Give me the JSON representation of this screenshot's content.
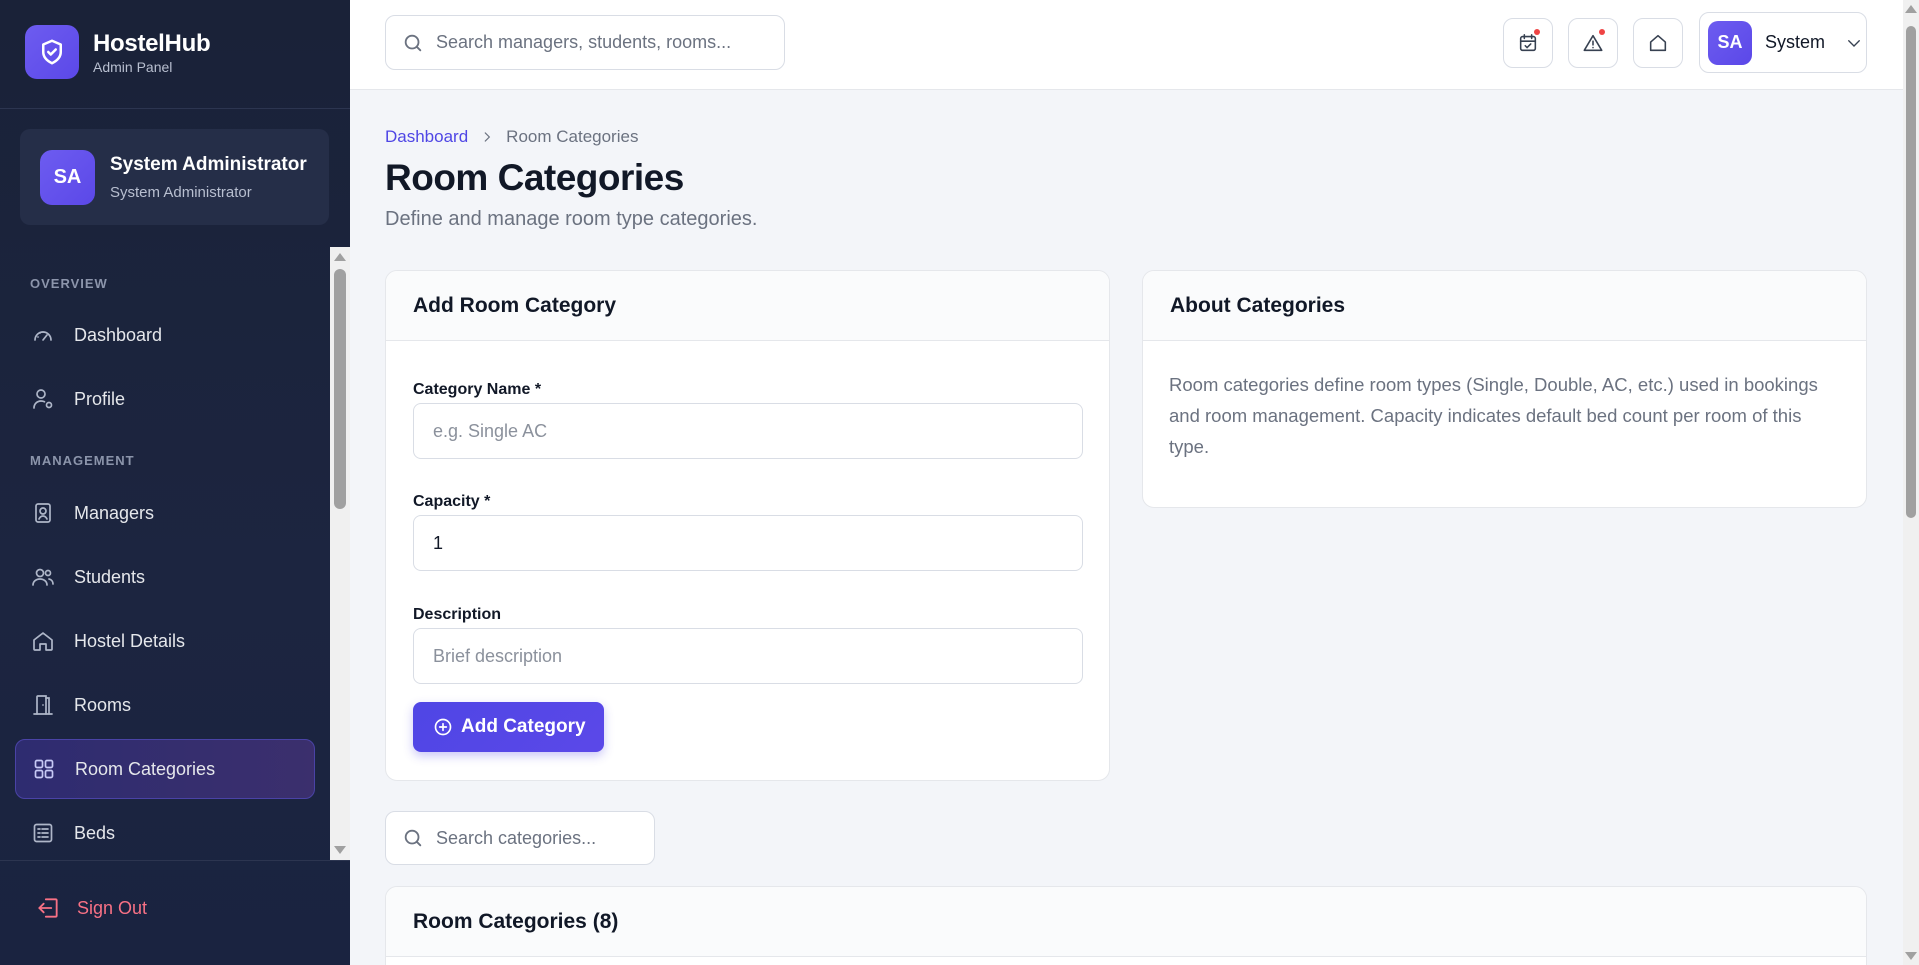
{
  "brand": {
    "name": "HostelHub",
    "subtitle": "Admin Panel"
  },
  "user": {
    "initials": "SA",
    "name": "System Administrator",
    "role": "System Administrator"
  },
  "nav": {
    "sections": [
      {
        "title": "OVERVIEW",
        "items": [
          {
            "label": "Dashboard",
            "icon": "gauge-icon"
          },
          {
            "label": "Profile",
            "icon": "user-gear-icon"
          }
        ]
      },
      {
        "title": "MANAGEMENT",
        "items": [
          {
            "label": "Managers",
            "icon": "id-badge-icon"
          },
          {
            "label": "Students",
            "icon": "users-icon"
          },
          {
            "label": "Hostel Details",
            "icon": "house-icon"
          },
          {
            "label": "Rooms",
            "icon": "door-icon"
          },
          {
            "label": "Room Categories",
            "icon": "grid-icon"
          },
          {
            "label": "Beds",
            "icon": "bed-list-icon"
          }
        ]
      }
    ],
    "active": "Room Categories",
    "sign_out": "Sign Out"
  },
  "topbar": {
    "search_placeholder": "Search managers, students, rooms...",
    "buttons": [
      {
        "icon": "calendar-check-icon",
        "badge": true
      },
      {
        "icon": "warning-icon",
        "badge": true
      },
      {
        "icon": "home-icon",
        "badge": false
      }
    ],
    "profile": {
      "initials": "SA",
      "name": "System"
    }
  },
  "breadcrumb": {
    "root": "Dashboard",
    "current": "Room Categories"
  },
  "page": {
    "title": "Room Categories",
    "subtitle": "Define and manage room type categories."
  },
  "add_form": {
    "title": "Add Room Category",
    "name_label": "Category Name *",
    "name_placeholder": "e.g. Single AC",
    "capacity_label": "Capacity *",
    "capacity_value": "1",
    "description_label": "Description",
    "description_placeholder": "Brief description",
    "submit_label": "Add Category"
  },
  "about": {
    "title": "About Categories",
    "text": "Room categories define room types (Single, Double, AC, etc.) used in bookings and room management. Capacity indicates default bed count per room of this type."
  },
  "list": {
    "search_placeholder": "Search categories...",
    "title": "Room Categories (8)"
  },
  "colors": {
    "accent": "#4f46e5",
    "sidebar_bg": "#1a2238",
    "danger": "#f87185"
  }
}
